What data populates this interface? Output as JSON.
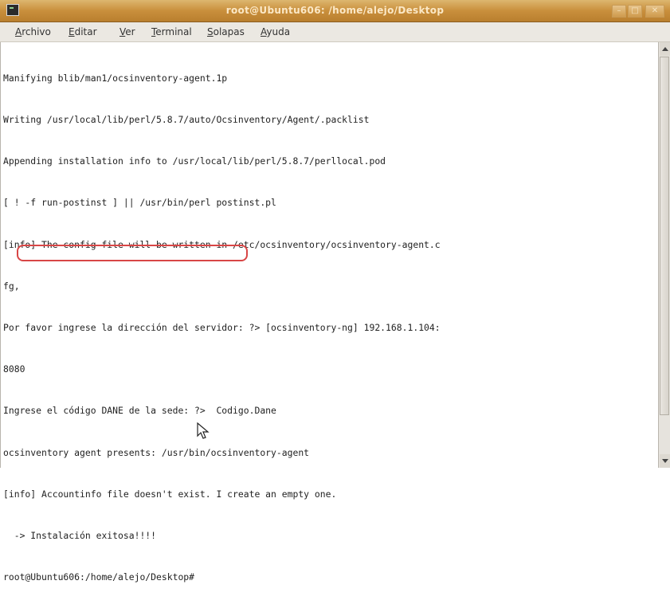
{
  "window": {
    "title": "root@Ubuntu606: /home/alejo/Desktop",
    "controls": {
      "minimize_icon": "minimize-icon",
      "maximize_icon": "maximize-icon",
      "close_icon": "close-icon"
    },
    "colors": {
      "titlebar": "#c98f3c",
      "highlight": "#d84646"
    }
  },
  "menu": [
    {
      "accel": "A",
      "rest": "rchivo"
    },
    {
      "accel": "E",
      "rest": "ditar"
    },
    {
      "accel": "V",
      "rest": "er"
    },
    {
      "accel": "T",
      "rest": "erminal"
    },
    {
      "accel": "S",
      "rest": "olapas"
    },
    {
      "accel": "A",
      "rest": "yuda"
    }
  ],
  "terminal": {
    "lines": [
      "Manifying blib/man1/ocsinventory-agent.1p",
      "Writing /usr/local/lib/perl/5.8.7/auto/Ocsinventory/Agent/.packlist",
      "Appending installation info to /usr/local/lib/perl/5.8.7/perllocal.pod",
      "[ ! -f run-postinst ] || /usr/bin/perl postinst.pl",
      "[info] The config file will be written in /etc/ocsinventory/ocsinventory-agent.c",
      "fg,",
      "Por favor ingrese la dirección del servidor: ?> [ocsinventory-ng] 192.168.1.104:",
      "8080",
      "Ingrese el código DANE de la sede: ?>  Codigo.Dane",
      "ocsinventory agent presents: /usr/bin/ocsinventory-agent",
      "[info] Accountinfo file doesn't exist. I create an empty one.",
      "  -> Instalación exitosa!!!!",
      "root@Ubuntu606:/home/alejo/Desktop#"
    ]
  }
}
